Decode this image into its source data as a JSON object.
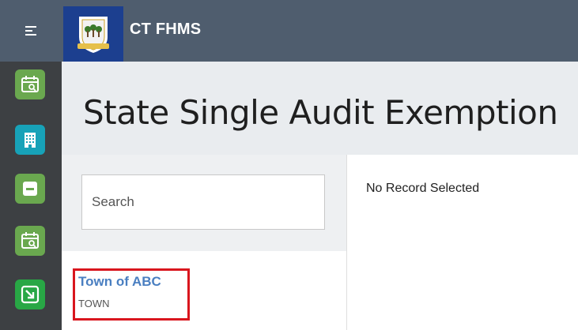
{
  "header": {
    "app_title": "CT FHMS",
    "menu_icon": "hamburger-menu-icon",
    "logo": "connecticut-state-seal"
  },
  "sidebar": {
    "items": [
      {
        "icon": "calendar-search-icon",
        "color": "#6aa84f"
      },
      {
        "icon": "building-icon",
        "color": "#17a2b8"
      },
      {
        "icon": "minus-box-icon",
        "color": "#6aa84f"
      },
      {
        "icon": "calendar-search-icon",
        "color": "#6aa84f"
      },
      {
        "icon": "arrow-down-right-box-icon",
        "color": "#28a745"
      }
    ]
  },
  "page": {
    "title": "State Single Audit Exemption"
  },
  "search": {
    "placeholder": "Search",
    "value": ""
  },
  "records": [
    {
      "name": "Town of ABC",
      "type": "TOWN"
    }
  ],
  "detail": {
    "empty_text": "No Record Selected"
  },
  "colors": {
    "header_bg": "#4f5d6e",
    "nav_bg": "#3d4043",
    "link": "#4a7fc1",
    "highlight": "#d9161e"
  }
}
